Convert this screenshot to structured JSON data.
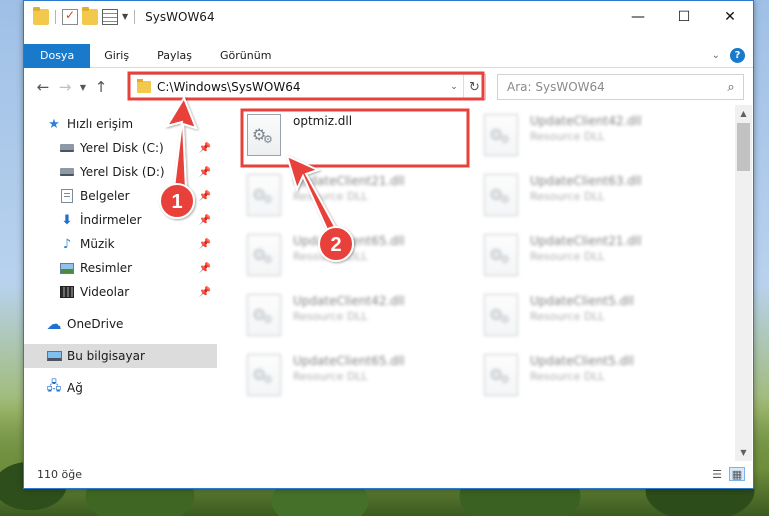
{
  "window": {
    "title": "SysWOW64",
    "controls": [
      "—",
      "☐",
      "✕"
    ],
    "accent": "#1979ca"
  },
  "ribbon": {
    "tabs": [
      "Dosya",
      "Giriş",
      "Paylaş",
      "Görünüm"
    ],
    "active_tab": "Dosya",
    "help": "?"
  },
  "address_bar": {
    "path": "C:\\Windows\\SysWOW64",
    "search_placeholder": "Ara: SysWOW64"
  },
  "sidebar": {
    "items": [
      {
        "label": "Hızlı erişim",
        "icon": "star-icon",
        "pinned": false
      },
      {
        "label": "Yerel Disk (C:)",
        "icon": "drive-icon",
        "pinned": true
      },
      {
        "label": "Yerel Disk (D:)",
        "icon": "drive-icon",
        "pinned": true
      },
      {
        "label": "Belgeler",
        "icon": "documents-icon",
        "pinned": true
      },
      {
        "label": "İndirmeler",
        "icon": "downloads-icon",
        "pinned": true
      },
      {
        "label": "Müzik",
        "icon": "music-icon",
        "pinned": true
      },
      {
        "label": "Resimler",
        "icon": "pictures-icon",
        "pinned": true
      },
      {
        "label": "Videolar",
        "icon": "videos-icon",
        "pinned": true
      },
      {
        "label": "OneDrive",
        "icon": "onedrive-icon",
        "pinned": false
      },
      {
        "label": "Bu bilgisayar",
        "icon": "this-pc-icon",
        "pinned": false,
        "selected": true
      },
      {
        "label": "Ağ",
        "icon": "network-icon",
        "pinned": false
      }
    ]
  },
  "files": [
    {
      "name": "optmiz.dll",
      "type": "",
      "highlighted": true
    },
    {
      "name": "UpdateClient42.dll",
      "type": "Resource DLL"
    },
    {
      "name": "UpdateClient21.dll",
      "type": "Resource DLL"
    },
    {
      "name": "UpdateClient63.dll",
      "type": "Resource DLL"
    },
    {
      "name": "UpdateClient65.dll",
      "type": "Resource DLL"
    },
    {
      "name": "UpdateClient21.dll",
      "type": "Resource DLL"
    },
    {
      "name": "UpdateClient42.dll",
      "type": "Resource DLL"
    },
    {
      "name": "UpdateClient5.dll",
      "type": "Resource DLL"
    },
    {
      "name": "UpdateClient65.dll",
      "type": "Resource DLL"
    },
    {
      "name": "UpdateClient5.dll",
      "type": "Resource DLL"
    }
  ],
  "status": {
    "item_count": "110 öğe"
  },
  "annotations": {
    "step1": "1",
    "step2": "2",
    "color": "#e8403a"
  }
}
